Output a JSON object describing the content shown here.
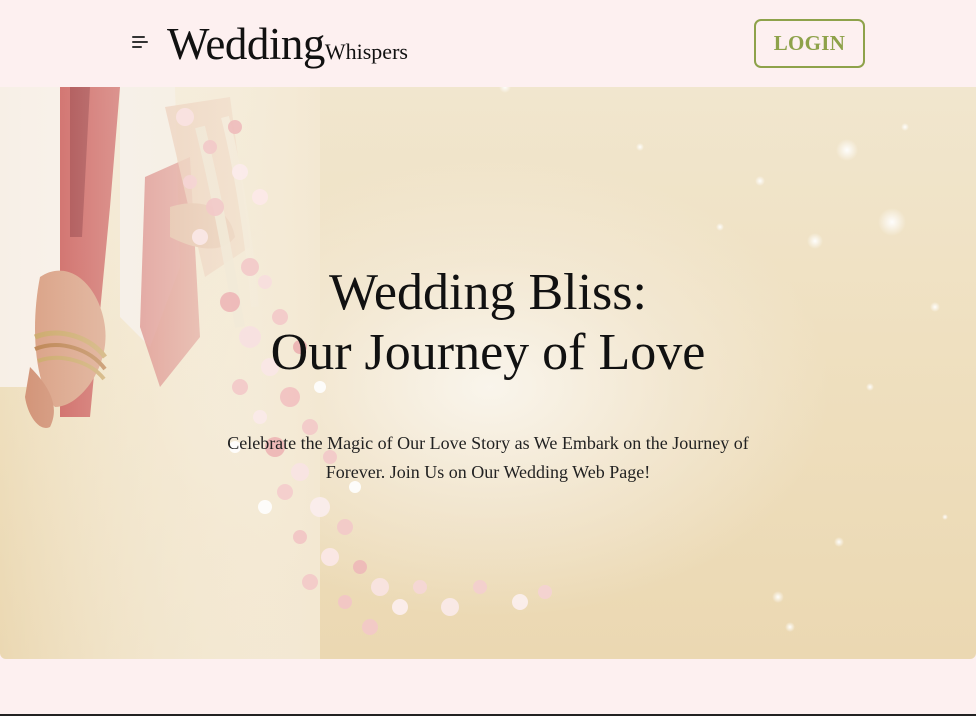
{
  "header": {
    "brand_main": "Wedding",
    "brand_sub": "Whispers",
    "menu_icon": "hamburger-menu-icon",
    "login_label": "LOGIN"
  },
  "hero": {
    "title_line1": "Wedding Bliss:",
    "title_line2": "Our Journey of Love",
    "subtitle_line1": "Celebrate the Magic of Our Love Story as We Embark on the Journey of",
    "subtitle_line2": "Forever. Join Us on Our Wedding Web Page!"
  },
  "colors": {
    "page_bg": "#fdf0f0",
    "accent": "#8ea24a",
    "hero_bg": "#efe0c0",
    "text": "#111111"
  }
}
